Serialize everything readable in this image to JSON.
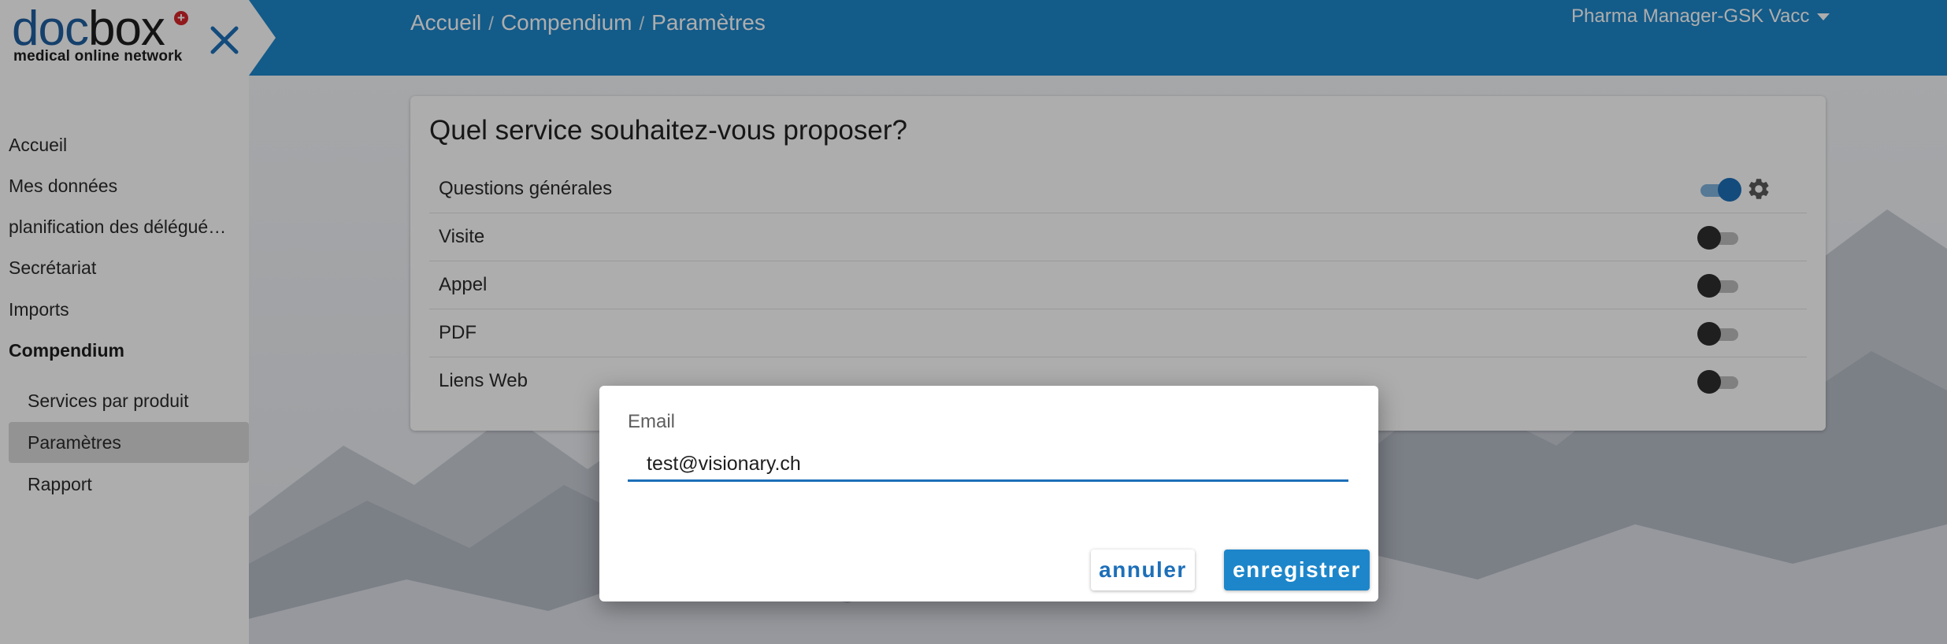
{
  "app": {
    "logo_doc": "doc",
    "logo_box": "box",
    "logo_tagline": "medical online network",
    "close_icon": "close-icon"
  },
  "breadcrumb": {
    "items": [
      "Accueil",
      "Compendium",
      "Paramètres"
    ],
    "separator": "/"
  },
  "user_menu": {
    "label": "Pharma Manager-GSK Vacc",
    "icon": "caret-down-icon"
  },
  "sidebar": {
    "items": [
      {
        "label": "Accueil"
      },
      {
        "label": "Mes données"
      },
      {
        "label": "planification des délégué…"
      },
      {
        "label": "Secrétariat"
      },
      {
        "label": "Imports"
      },
      {
        "label": "Compendium",
        "bold": true
      }
    ],
    "sub_items": [
      {
        "label": "Services par produit"
      },
      {
        "label": "Paramètres",
        "active": true
      },
      {
        "label": "Rapport"
      }
    ]
  },
  "card": {
    "title": "Quel service souhaitez-vous proposer?",
    "services": [
      {
        "label": "Questions générales",
        "enabled": true,
        "has_settings": true
      },
      {
        "label": "Visite",
        "enabled": false
      },
      {
        "label": "Appel",
        "enabled": false
      },
      {
        "label": "PDF",
        "enabled": false
      },
      {
        "label": "Liens Web",
        "enabled": false
      }
    ]
  },
  "dialog": {
    "field_label": "Email",
    "field_value": "test@visionary.ch",
    "cancel_label": "annuler",
    "save_label": "enregistrer"
  },
  "colors": {
    "primary": "#1d86ca",
    "primary_dark": "#1d6fb8",
    "logo_blue": "#1f5fa0",
    "logo_red": "#d6262a"
  }
}
